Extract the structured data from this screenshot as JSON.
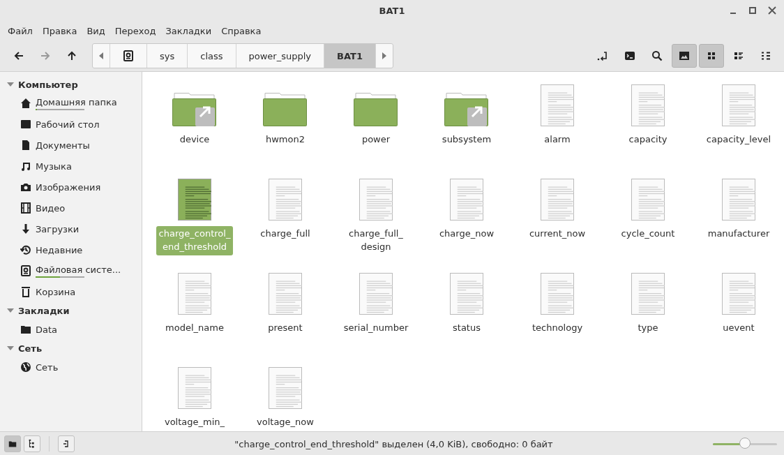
{
  "window": {
    "title": "BAT1"
  },
  "menu": [
    "Файл",
    "Правка",
    "Вид",
    "Переход",
    "Закладки",
    "Справка"
  ],
  "nav": [
    {
      "kind": "back",
      "disabled": false
    },
    {
      "kind": "forward",
      "disabled": true
    },
    {
      "kind": "up",
      "disabled": false
    }
  ],
  "path": [
    {
      "kind": "drive",
      "selected": false
    },
    {
      "kind": "text",
      "label": "sys",
      "selected": false
    },
    {
      "kind": "text",
      "label": "class",
      "selected": false
    },
    {
      "kind": "text",
      "label": "power_supply",
      "selected": false
    },
    {
      "kind": "text",
      "label": "BAT1",
      "selected": true
    }
  ],
  "tools": [
    {
      "kind": "enter",
      "selected": false
    },
    {
      "kind": "terminal",
      "selected": false
    },
    {
      "kind": "search",
      "selected": false
    },
    {
      "kind": "image",
      "selected": true
    },
    {
      "kind": "icons",
      "selected": true
    },
    {
      "kind": "list",
      "selected": false
    },
    {
      "kind": "compact",
      "selected": false
    }
  ],
  "sidebar": [
    {
      "title": "Компьютер",
      "expanded": true,
      "items": [
        {
          "label": "Домашняя папка",
          "kind": "home",
          "level": 0.03
        },
        {
          "label": "Рабочий стол",
          "kind": "desktop"
        },
        {
          "label": "Документы",
          "kind": "document"
        },
        {
          "label": "Музыка",
          "kind": "music"
        },
        {
          "label": "Изображения",
          "kind": "camera"
        },
        {
          "label": "Видео",
          "kind": "film"
        },
        {
          "label": "Загрузки",
          "kind": "download"
        },
        {
          "label": "Недавние",
          "kind": "recent"
        },
        {
          "label": "Файловая систе...",
          "kind": "drive",
          "level": 0.5
        },
        {
          "label": "Корзина",
          "kind": "trash"
        }
      ]
    },
    {
      "title": "Закладки",
      "expanded": true,
      "items": [
        {
          "label": "Data",
          "kind": "folder"
        }
      ]
    },
    {
      "title": "Сеть",
      "expanded": true,
      "items": [
        {
          "label": "Сеть",
          "kind": "network"
        }
      ]
    }
  ],
  "files": [
    {
      "name": "device",
      "kind": "folder",
      "link": true,
      "selected": false
    },
    {
      "name": "hwmon2",
      "kind": "folder",
      "link": false,
      "selected": false
    },
    {
      "name": "power",
      "kind": "folder",
      "link": false,
      "selected": false
    },
    {
      "name": "subsystem",
      "kind": "folder",
      "link": true,
      "selected": false
    },
    {
      "name": "alarm",
      "kind": "file",
      "selected": false
    },
    {
      "name": "capacity",
      "kind": "file",
      "selected": false
    },
    {
      "name": "capacity_level",
      "kind": "file",
      "selected": false
    },
    {
      "name": "charge_control_\nend_threshold",
      "kind": "file",
      "selected": true
    },
    {
      "name": "charge_full",
      "kind": "file",
      "selected": false
    },
    {
      "name": "charge_full_\ndesign",
      "kind": "file",
      "selected": false
    },
    {
      "name": "charge_now",
      "kind": "file",
      "selected": false
    },
    {
      "name": "current_now",
      "kind": "file",
      "selected": false
    },
    {
      "name": "cycle_count",
      "kind": "file",
      "selected": false
    },
    {
      "name": "manufacturer",
      "kind": "file",
      "selected": false
    },
    {
      "name": "model_name",
      "kind": "file",
      "selected": false
    },
    {
      "name": "present",
      "kind": "file",
      "selected": false
    },
    {
      "name": "serial_number",
      "kind": "file",
      "selected": false
    },
    {
      "name": "status",
      "kind": "file",
      "selected": false
    },
    {
      "name": "technology",
      "kind": "file",
      "selected": false
    },
    {
      "name": "type",
      "kind": "file",
      "selected": false
    },
    {
      "name": "uevent",
      "kind": "file",
      "selected": false
    },
    {
      "name": "voltage_min_",
      "kind": "file",
      "selected": false
    },
    {
      "name": "voltage_now",
      "kind": "file",
      "selected": false
    }
  ],
  "status_bar": {
    "toggles": [
      {
        "kind": "places",
        "selected": true
      },
      {
        "kind": "tree",
        "selected": false
      }
    ],
    "text": "\"charge_control_end_threshold\" выделен (4,0 KiB), свободно: 0 байт",
    "zoom": {
      "level": 0.5
    }
  }
}
